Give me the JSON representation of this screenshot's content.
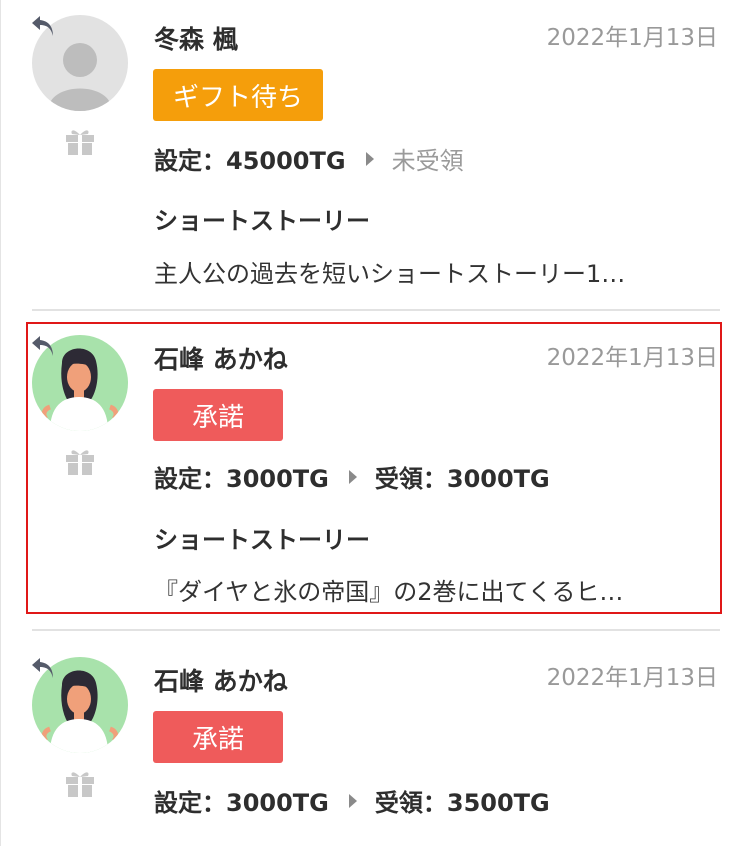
{
  "messages": [
    {
      "sender": "冬森 楓",
      "date": "2022年1月13日",
      "status": "ギフト待ち",
      "setting": "設定：45000TG",
      "received": "未受領",
      "section_title": "ショートストーリー",
      "story_preview": "主人公の過去を短いショートストーリー1…",
      "avatar": "default-user-avatar"
    },
    {
      "sender": "石峰 あかね",
      "date": "2022年1月13日",
      "status": "承諾",
      "setting": "設定：3000TG",
      "received": "受領：3000TG",
      "section_title": "ショートストーリー",
      "story_preview": "『ダイヤと氷の帝国』の2巻に出てくるヒ…",
      "avatar": "woman-avatar",
      "highlighted": true
    },
    {
      "sender": "石峰 あかね",
      "date": "2022年1月13日",
      "status": "承諾",
      "setting": "設定：3000TG",
      "received": "受領：3500TG",
      "avatar": "woman-avatar"
    }
  ],
  "colors": {
    "waiting": "#f59e0b",
    "accepted": "#ef5b5b",
    "highlight_border": "#e01818",
    "avatar_green": "#a8e2ab"
  },
  "icons": [
    "reply-icon",
    "gift-icon",
    "caret-right-icon"
  ]
}
